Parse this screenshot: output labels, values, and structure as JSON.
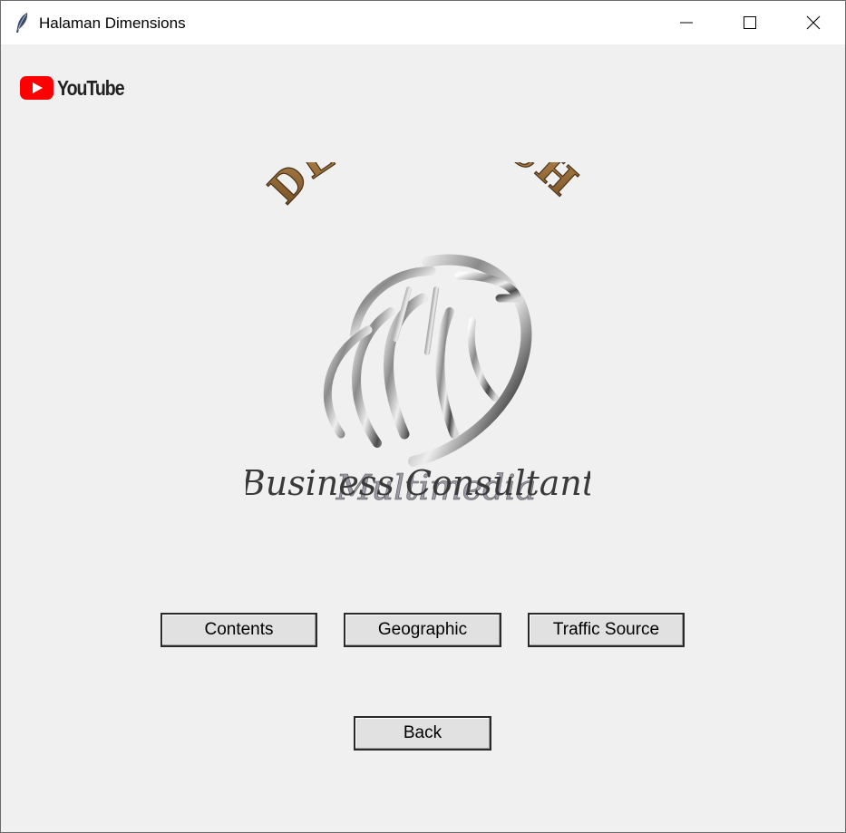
{
  "window": {
    "title": "Halaman Dimensions",
    "controls": {
      "minimize": "minimize-icon",
      "maximize": "maximize-icon",
      "close": "close-icon"
    }
  },
  "youtube_logo": {
    "text": "YouTube",
    "brand_color": "#ff0000"
  },
  "brand": {
    "top_text": "DEEV@TECH",
    "line1": "Multimedia",
    "line2": "Business Consultant",
    "gold_color": "#b08850"
  },
  "buttons": {
    "contents": "Contents",
    "geographic": "Geographic",
    "traffic_source": "Traffic Source",
    "back": "Back"
  }
}
